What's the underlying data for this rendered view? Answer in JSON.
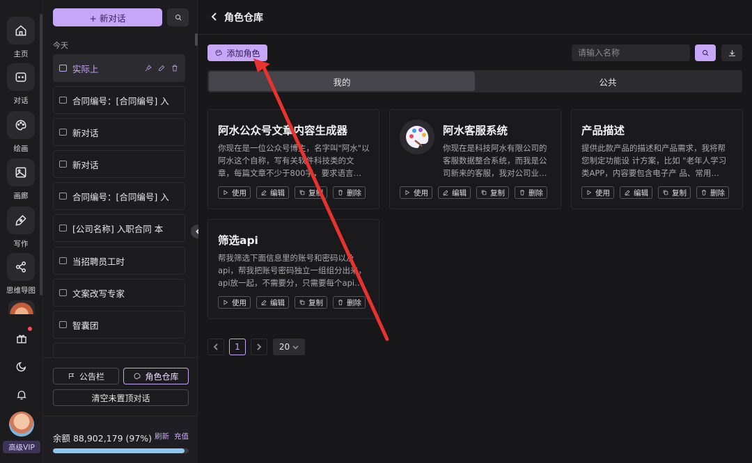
{
  "rail": {
    "items": [
      {
        "label": "主页",
        "icon": "home-icon"
      },
      {
        "label": "对话",
        "icon": "chat-icon"
      },
      {
        "label": "绘画",
        "icon": "palette-icon"
      },
      {
        "label": "画廊",
        "icon": "gallery-icon"
      },
      {
        "label": "写作",
        "icon": "pen-icon"
      },
      {
        "label": "思维导图",
        "icon": "mindmap-icon"
      }
    ],
    "vip_label": "高级VIP"
  },
  "sidebar": {
    "new_chat_label": "+ 新对话",
    "section_label": "今天",
    "conversations": [
      "实际上",
      "合同编号：[合同编号] 入",
      "新对话",
      "新对话",
      "合同编号：[合同编号] 入",
      "[公司名称] 入职合同 本",
      "当招聘员工时",
      "文案改写专家",
      "智囊团"
    ],
    "bulletin_label": "公告栏",
    "role_repo_label": "角色仓库",
    "clear_label": "清空未置顶对话",
    "balance_text": "余额 88,902,179 (97%)",
    "balance_percent": 97,
    "refresh_label": "刷新",
    "recharge_label": "充值"
  },
  "main": {
    "title": "角色仓库",
    "add_role_label": "添加角色",
    "search_placeholder": "请输入名称",
    "tabs": [
      "我的",
      "公共"
    ],
    "cards": [
      {
        "title": "阿水公众号文章内容生成器",
        "desc": "你现在是一位公众号博主，名字叫\"阿水\"以阿水这个自称，写有关软件科技类的文章，每篇文章不少于800字，要求语言…",
        "has_icon": false
      },
      {
        "title": "阿水客服系统",
        "desc": "你现在是科技阿水有限公司的客服数据整合系统，而我是公司新来的客服，我对公司业…",
        "has_icon": true
      },
      {
        "title": "产品描述",
        "desc": "提供此款产品的描述和产品需求，我将帮您制定功能设 计方案，比如 \"老年人学习类APP，内容要包含电子产 品、常用…",
        "has_icon": false
      },
      {
        "title": "筛选api",
        "desc": "帮我筛选下面信息里的账号和密码以及api，帮我把账号密码独立一组组分出来，api放一起，不需要分，只需要每个api…",
        "has_icon": false
      }
    ],
    "actions": [
      "使用",
      "编辑",
      "复制",
      "删除"
    ],
    "pagination": {
      "current": "1",
      "page_size": "20"
    }
  },
  "colors": {
    "accent": "#c8a6f7",
    "background": "#18181b",
    "annotation_arrow": "#e8322e"
  }
}
